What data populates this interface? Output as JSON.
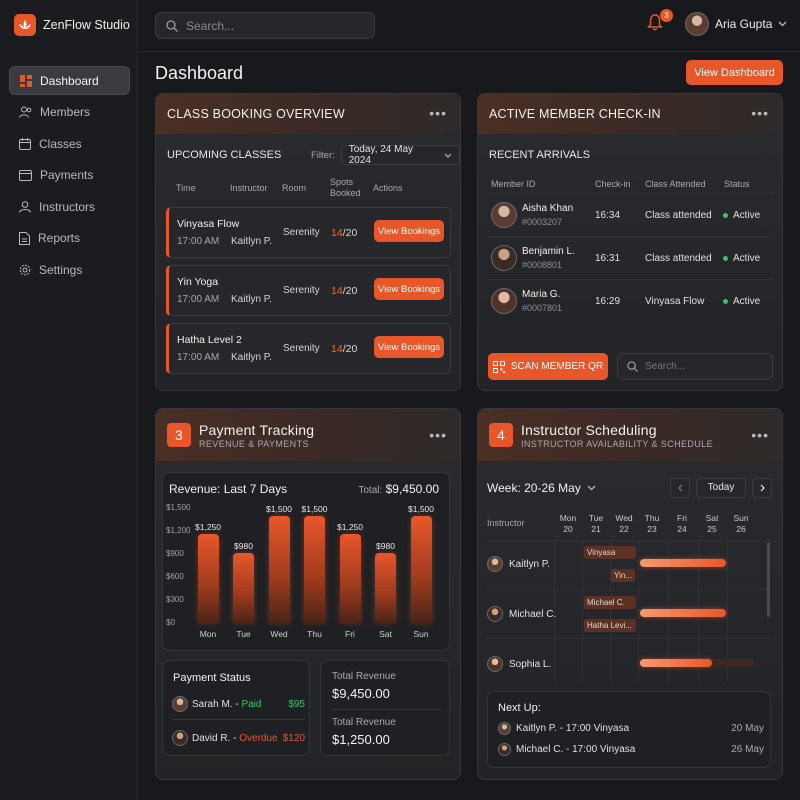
{
  "app": {
    "name": "ZenFlow Studio"
  },
  "sidebar": {
    "items": [
      {
        "label": "Dashboard",
        "icon": "dashboard-icon"
      },
      {
        "label": "Members",
        "icon": "members-icon"
      },
      {
        "label": "Classes",
        "icon": "calendar-icon"
      },
      {
        "label": "Payments",
        "icon": "card-icon"
      },
      {
        "label": "Instructors",
        "icon": "instructors-icon"
      },
      {
        "label": "Reports",
        "icon": "report-icon"
      },
      {
        "label": "Settings",
        "icon": "gear-icon"
      }
    ]
  },
  "header": {
    "search_placeholder": "Search...",
    "notification_count": "3",
    "user_name": "Aria Gupta"
  },
  "page": {
    "title": "Dashboard",
    "view_button": "View Dashboard"
  },
  "booking": {
    "title": "CLASS BOOKING OVERVIEW",
    "subtitle": "UPCOMING CLASSES",
    "filter_label": "Filter:",
    "filter_value": "Today, 24 May 2024",
    "columns": [
      "Time",
      "Instructor",
      "Room",
      "Spots Booked",
      "Actions"
    ],
    "rows": [
      {
        "name": "Vinyasa Flow",
        "time": "17:00 AM",
        "instructor": "Kaitlyn P.",
        "room": "Serenity",
        "booked": "14",
        "capacity": "/20",
        "action": "View Bookings"
      },
      {
        "name": "Yin Yoga",
        "time": "17:00 AM",
        "instructor": "Kaitlyn P.",
        "room": "Serenity",
        "booked": "14",
        "capacity": "/20",
        "action": "View Bookings"
      },
      {
        "name": "Hatha Level 2",
        "time": "17:00 AM",
        "instructor": "Kaitlyn P.",
        "room": "Serenity",
        "booked": "14",
        "capacity": "/20",
        "action": "View Bookings"
      }
    ]
  },
  "checkin": {
    "title": "ACTIVE MEMBER CHECK-IN",
    "subtitle": "RECENT ARRIVALS",
    "columns": [
      "Member ID",
      "Check-in",
      "Class Attended",
      "Status"
    ],
    "rows": [
      {
        "name": "Aisha Khan",
        "id": "#0003207",
        "time": "16:34",
        "class": "Class attended",
        "status": "Active"
      },
      {
        "name": "Benjamin L.",
        "id": "#0008801",
        "time": "16:31",
        "class": "Class attended",
        "status": "Active"
      },
      {
        "name": "Maria G.",
        "id": "#0007801",
        "time": "16:29",
        "class": "Vinyasa Flow",
        "status": "Active"
      }
    ],
    "scan_button": "SCAN MEMBER QR",
    "search_placeholder": "Search..."
  },
  "payments": {
    "number": "3",
    "title": "Payment Tracking",
    "subtitle": "REVENUE & PAYMENTS",
    "chart_title": "Revenue: Last 7 Days",
    "total_label": "Total:",
    "total_value": "$9,450.00",
    "status_title": "Payment Status",
    "status_rows": [
      {
        "name": "Sarah M.",
        "sep": " - ",
        "status": "Paid",
        "amount": "$95",
        "color": "#35c46a"
      },
      {
        "name": "David R.",
        "sep": " - ",
        "status": "Overdue",
        "amount": "$120",
        "color": "#e8572a"
      }
    ],
    "totals": [
      {
        "label": "Total Revenue",
        "value": "$9,450.00"
      },
      {
        "label": "Total Revenue",
        "value": "$1,250.00"
      }
    ]
  },
  "chart_data": {
    "type": "bar",
    "title": "Revenue: Last 7 Days",
    "categories": [
      "Mon",
      "Tue",
      "Wed",
      "Thu",
      "Fri",
      "Sat",
      "Sun"
    ],
    "values": [
      1250,
      980,
      1500,
      1500,
      1250,
      980,
      1500
    ],
    "value_labels": [
      "$1,250",
      "$980",
      "$1,500",
      "$1,500",
      "$1,250",
      "$980",
      "$1,500"
    ],
    "y_ticks": [
      "$1,500",
      "$1,200",
      "$900",
      "$600",
      "$300",
      "$0"
    ],
    "ylim": [
      0,
      1500
    ],
    "grid": true,
    "color": "#e8572a"
  },
  "schedule": {
    "number": "4",
    "title": "Instructor Scheduling",
    "subtitle": "INSTRUCTOR AVAILABILITY & SCHEDULE",
    "week_label": "Week: 20-26 May",
    "today_button": "Today",
    "instructor_col": "Instructor",
    "days": [
      {
        "d": "Mon",
        "n": "20"
      },
      {
        "d": "Tue",
        "n": "21"
      },
      {
        "d": "Wed",
        "n": "22"
      },
      {
        "d": "Thu",
        "n": "23"
      },
      {
        "d": "Fri",
        "n": "24"
      },
      {
        "d": "Sat",
        "n": "25"
      },
      {
        "d": "Sun",
        "n": "26"
      }
    ],
    "instructors": [
      "Kaitlyn P.",
      "Michael C.",
      "Sophia L."
    ],
    "chips": [
      "Vinyasa",
      "Yin...",
      "Michael C.",
      "Hatha Levi..."
    ],
    "next_up_title": "Next Up:",
    "next_up": [
      {
        "text": "Kaitlyn P. - 17:00 Vinyasa",
        "date": "20 May"
      },
      {
        "text": "Michael C. - 17:00 Vinyasa",
        "date": "26 May"
      }
    ]
  }
}
